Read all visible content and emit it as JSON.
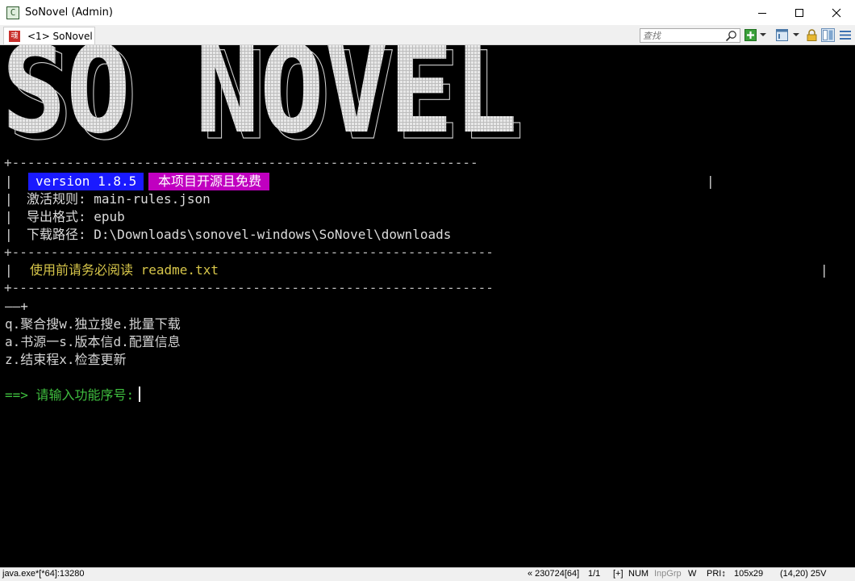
{
  "window": {
    "title": "SoNovel (Admin)",
    "app_icon_glyph": "C",
    "minimize_icon": "minimize-icon",
    "maximize_icon": "maximize-icon",
    "close_icon": "close-icon"
  },
  "tabs": [
    {
      "label": "<1> SoNovel",
      "icon_glyph": "魂"
    }
  ],
  "toolbar": {
    "search_placeholder": "查找"
  },
  "terminal": {
    "banner_text": "SO NOVEL",
    "border_top": "+------------------------------------------------------------",
    "border_mid": "+--------------------------------------------------------------",
    "border_bot": "+--------------------------------------------------------------",
    "version_tag": "version 1.8.5",
    "free_tag": "本项目开源且免费",
    "rules_label": "激活规则:",
    "rules_value": "main-rules.json",
    "format_label": "导出格式:",
    "format_value": "epub",
    "path_label": "下载路径:",
    "path_value": "D:\\Downloads\\sonovel-windows\\SoNovel\\downloads",
    "readme_notice": "使用前请务必阅读 readme.txt",
    "menu_border": "——+",
    "menu_rows": [
      "q.聚合搜w.独立搜e.批量下载",
      "a.书源一s.版本信d.配置信息",
      "z.结束程x.检查更新"
    ],
    "prompt": "==> 请输入功能序号:"
  },
  "status": {
    "process": "java.exe*[*64]:13280",
    "position": "« 230724[64]",
    "page": "1/1",
    "plus": "[+]",
    "num": "NUM",
    "inpgrp": "InpGrp",
    "w": "W",
    "pri": "PRI↕",
    "size": "105x29",
    "cursor_pos": "(14,20) 25V"
  },
  "colors": {
    "terminal_bg": "#000000",
    "version_bg": "#1a1aff",
    "free_bg": "#c000c0",
    "notice": "#d7c64a",
    "prompt": "#3fbf3f"
  }
}
